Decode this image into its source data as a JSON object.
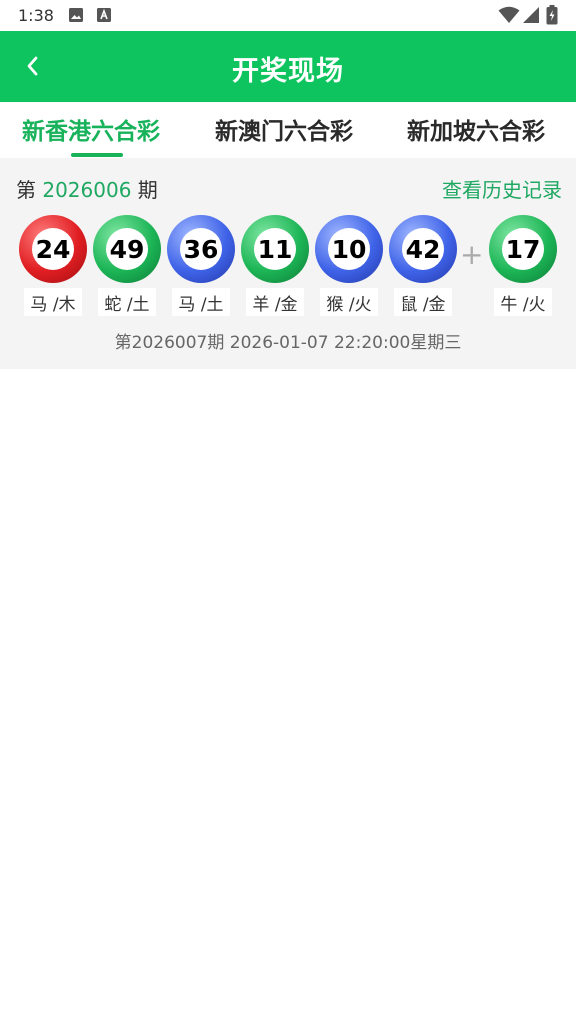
{
  "status_bar": {
    "time": "1:38",
    "icons": [
      "image-icon",
      "a-icon",
      "wifi-icon",
      "signal-icon",
      "battery-charging-icon"
    ]
  },
  "header": {
    "title": "开奖现场",
    "back_icon": "chevron-left-icon",
    "background": "#0ec45e"
  },
  "tabs": [
    {
      "label": "新香港六合彩",
      "active": true
    },
    {
      "label": "新澳门六合彩",
      "active": false
    },
    {
      "label": "新加坡六合彩",
      "active": false
    }
  ],
  "accent_color": "#17b25a",
  "draw": {
    "prefix": "第",
    "issue_number": "2026006",
    "suffix": "期",
    "history_link": "查看历史记录",
    "balls": [
      {
        "number": "24",
        "zodiac": "马 /木",
        "color": "red"
      },
      {
        "number": "49",
        "zodiac": "蛇 /土",
        "color": "green"
      },
      {
        "number": "36",
        "zodiac": "马 /土",
        "color": "blue"
      },
      {
        "number": "11",
        "zodiac": "羊 /金",
        "color": "green"
      },
      {
        "number": "10",
        "zodiac": "猴 /火",
        "color": "blue"
      },
      {
        "number": "42",
        "zodiac": "鼠 /金",
        "color": "blue"
      }
    ],
    "plus": "+",
    "special_ball": {
      "number": "17",
      "zodiac": "牛 /火",
      "color": "green"
    },
    "next_draw": "第2026007期 2026-01-07 22:20:00星期三"
  }
}
